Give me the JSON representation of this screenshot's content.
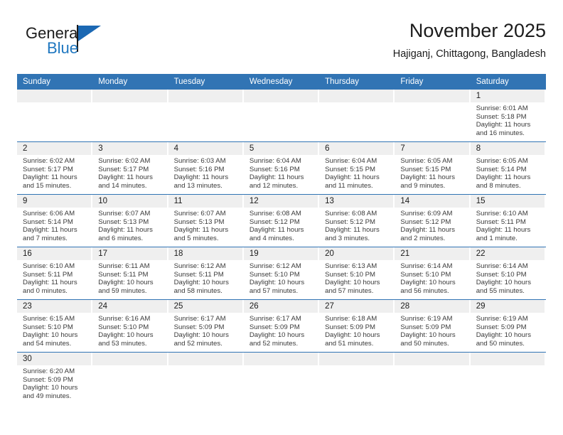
{
  "brand": {
    "name_top": "General",
    "name_bottom": "Blue",
    "accent_color": "#1f77c0",
    "flag_color": "#1b68b3"
  },
  "header": {
    "title": "November 2025",
    "subtitle": "Hajiganj, Chittagong, Bangladesh",
    "header_bg_color": "#3174b4",
    "header_text_color": "#ffffff"
  },
  "weekday_headers": [
    "Sunday",
    "Monday",
    "Tuesday",
    "Wednesday",
    "Thursday",
    "Friday",
    "Saturday"
  ],
  "weeks": [
    [
      {
        "day": "",
        "lines": []
      },
      {
        "day": "",
        "lines": []
      },
      {
        "day": "",
        "lines": []
      },
      {
        "day": "",
        "lines": []
      },
      {
        "day": "",
        "lines": []
      },
      {
        "day": "",
        "lines": []
      },
      {
        "day": "1",
        "lines": [
          "Sunrise: 6:01 AM",
          "Sunset: 5:18 PM",
          "Daylight: 11 hours",
          "and 16 minutes."
        ]
      }
    ],
    [
      {
        "day": "2",
        "lines": [
          "Sunrise: 6:02 AM",
          "Sunset: 5:17 PM",
          "Daylight: 11 hours",
          "and 15 minutes."
        ]
      },
      {
        "day": "3",
        "lines": [
          "Sunrise: 6:02 AM",
          "Sunset: 5:17 PM",
          "Daylight: 11 hours",
          "and 14 minutes."
        ]
      },
      {
        "day": "4",
        "lines": [
          "Sunrise: 6:03 AM",
          "Sunset: 5:16 PM",
          "Daylight: 11 hours",
          "and 13 minutes."
        ]
      },
      {
        "day": "5",
        "lines": [
          "Sunrise: 6:04 AM",
          "Sunset: 5:16 PM",
          "Daylight: 11 hours",
          "and 12 minutes."
        ]
      },
      {
        "day": "6",
        "lines": [
          "Sunrise: 6:04 AM",
          "Sunset: 5:15 PM",
          "Daylight: 11 hours",
          "and 11 minutes."
        ]
      },
      {
        "day": "7",
        "lines": [
          "Sunrise: 6:05 AM",
          "Sunset: 5:15 PM",
          "Daylight: 11 hours",
          "and 9 minutes."
        ]
      },
      {
        "day": "8",
        "lines": [
          "Sunrise: 6:05 AM",
          "Sunset: 5:14 PM",
          "Daylight: 11 hours",
          "and 8 minutes."
        ]
      }
    ],
    [
      {
        "day": "9",
        "lines": [
          "Sunrise: 6:06 AM",
          "Sunset: 5:14 PM",
          "Daylight: 11 hours",
          "and 7 minutes."
        ]
      },
      {
        "day": "10",
        "lines": [
          "Sunrise: 6:07 AM",
          "Sunset: 5:13 PM",
          "Daylight: 11 hours",
          "and 6 minutes."
        ]
      },
      {
        "day": "11",
        "lines": [
          "Sunrise: 6:07 AM",
          "Sunset: 5:13 PM",
          "Daylight: 11 hours",
          "and 5 minutes."
        ]
      },
      {
        "day": "12",
        "lines": [
          "Sunrise: 6:08 AM",
          "Sunset: 5:12 PM",
          "Daylight: 11 hours",
          "and 4 minutes."
        ]
      },
      {
        "day": "13",
        "lines": [
          "Sunrise: 6:08 AM",
          "Sunset: 5:12 PM",
          "Daylight: 11 hours",
          "and 3 minutes."
        ]
      },
      {
        "day": "14",
        "lines": [
          "Sunrise: 6:09 AM",
          "Sunset: 5:12 PM",
          "Daylight: 11 hours",
          "and 2 minutes."
        ]
      },
      {
        "day": "15",
        "lines": [
          "Sunrise: 6:10 AM",
          "Sunset: 5:11 PM",
          "Daylight: 11 hours",
          "and 1 minute."
        ]
      }
    ],
    [
      {
        "day": "16",
        "lines": [
          "Sunrise: 6:10 AM",
          "Sunset: 5:11 PM",
          "Daylight: 11 hours",
          "and 0 minutes."
        ]
      },
      {
        "day": "17",
        "lines": [
          "Sunrise: 6:11 AM",
          "Sunset: 5:11 PM",
          "Daylight: 10 hours",
          "and 59 minutes."
        ]
      },
      {
        "day": "18",
        "lines": [
          "Sunrise: 6:12 AM",
          "Sunset: 5:11 PM",
          "Daylight: 10 hours",
          "and 58 minutes."
        ]
      },
      {
        "day": "19",
        "lines": [
          "Sunrise: 6:12 AM",
          "Sunset: 5:10 PM",
          "Daylight: 10 hours",
          "and 57 minutes."
        ]
      },
      {
        "day": "20",
        "lines": [
          "Sunrise: 6:13 AM",
          "Sunset: 5:10 PM",
          "Daylight: 10 hours",
          "and 57 minutes."
        ]
      },
      {
        "day": "21",
        "lines": [
          "Sunrise: 6:14 AM",
          "Sunset: 5:10 PM",
          "Daylight: 10 hours",
          "and 56 minutes."
        ]
      },
      {
        "day": "22",
        "lines": [
          "Sunrise: 6:14 AM",
          "Sunset: 5:10 PM",
          "Daylight: 10 hours",
          "and 55 minutes."
        ]
      }
    ],
    [
      {
        "day": "23",
        "lines": [
          "Sunrise: 6:15 AM",
          "Sunset: 5:10 PM",
          "Daylight: 10 hours",
          "and 54 minutes."
        ]
      },
      {
        "day": "24",
        "lines": [
          "Sunrise: 6:16 AM",
          "Sunset: 5:10 PM",
          "Daylight: 10 hours",
          "and 53 minutes."
        ]
      },
      {
        "day": "25",
        "lines": [
          "Sunrise: 6:17 AM",
          "Sunset: 5:09 PM",
          "Daylight: 10 hours",
          "and 52 minutes."
        ]
      },
      {
        "day": "26",
        "lines": [
          "Sunrise: 6:17 AM",
          "Sunset: 5:09 PM",
          "Daylight: 10 hours",
          "and 52 minutes."
        ]
      },
      {
        "day": "27",
        "lines": [
          "Sunrise: 6:18 AM",
          "Sunset: 5:09 PM",
          "Daylight: 10 hours",
          "and 51 minutes."
        ]
      },
      {
        "day": "28",
        "lines": [
          "Sunrise: 6:19 AM",
          "Sunset: 5:09 PM",
          "Daylight: 10 hours",
          "and 50 minutes."
        ]
      },
      {
        "day": "29",
        "lines": [
          "Sunrise: 6:19 AM",
          "Sunset: 5:09 PM",
          "Daylight: 10 hours",
          "and 50 minutes."
        ]
      }
    ],
    [
      {
        "day": "30",
        "lines": [
          "Sunrise: 6:20 AM",
          "Sunset: 5:09 PM",
          "Daylight: 10 hours",
          "and 49 minutes."
        ]
      },
      {
        "day": "",
        "lines": []
      },
      {
        "day": "",
        "lines": []
      },
      {
        "day": "",
        "lines": []
      },
      {
        "day": "",
        "lines": []
      },
      {
        "day": "",
        "lines": []
      },
      {
        "day": "",
        "lines": []
      }
    ]
  ]
}
